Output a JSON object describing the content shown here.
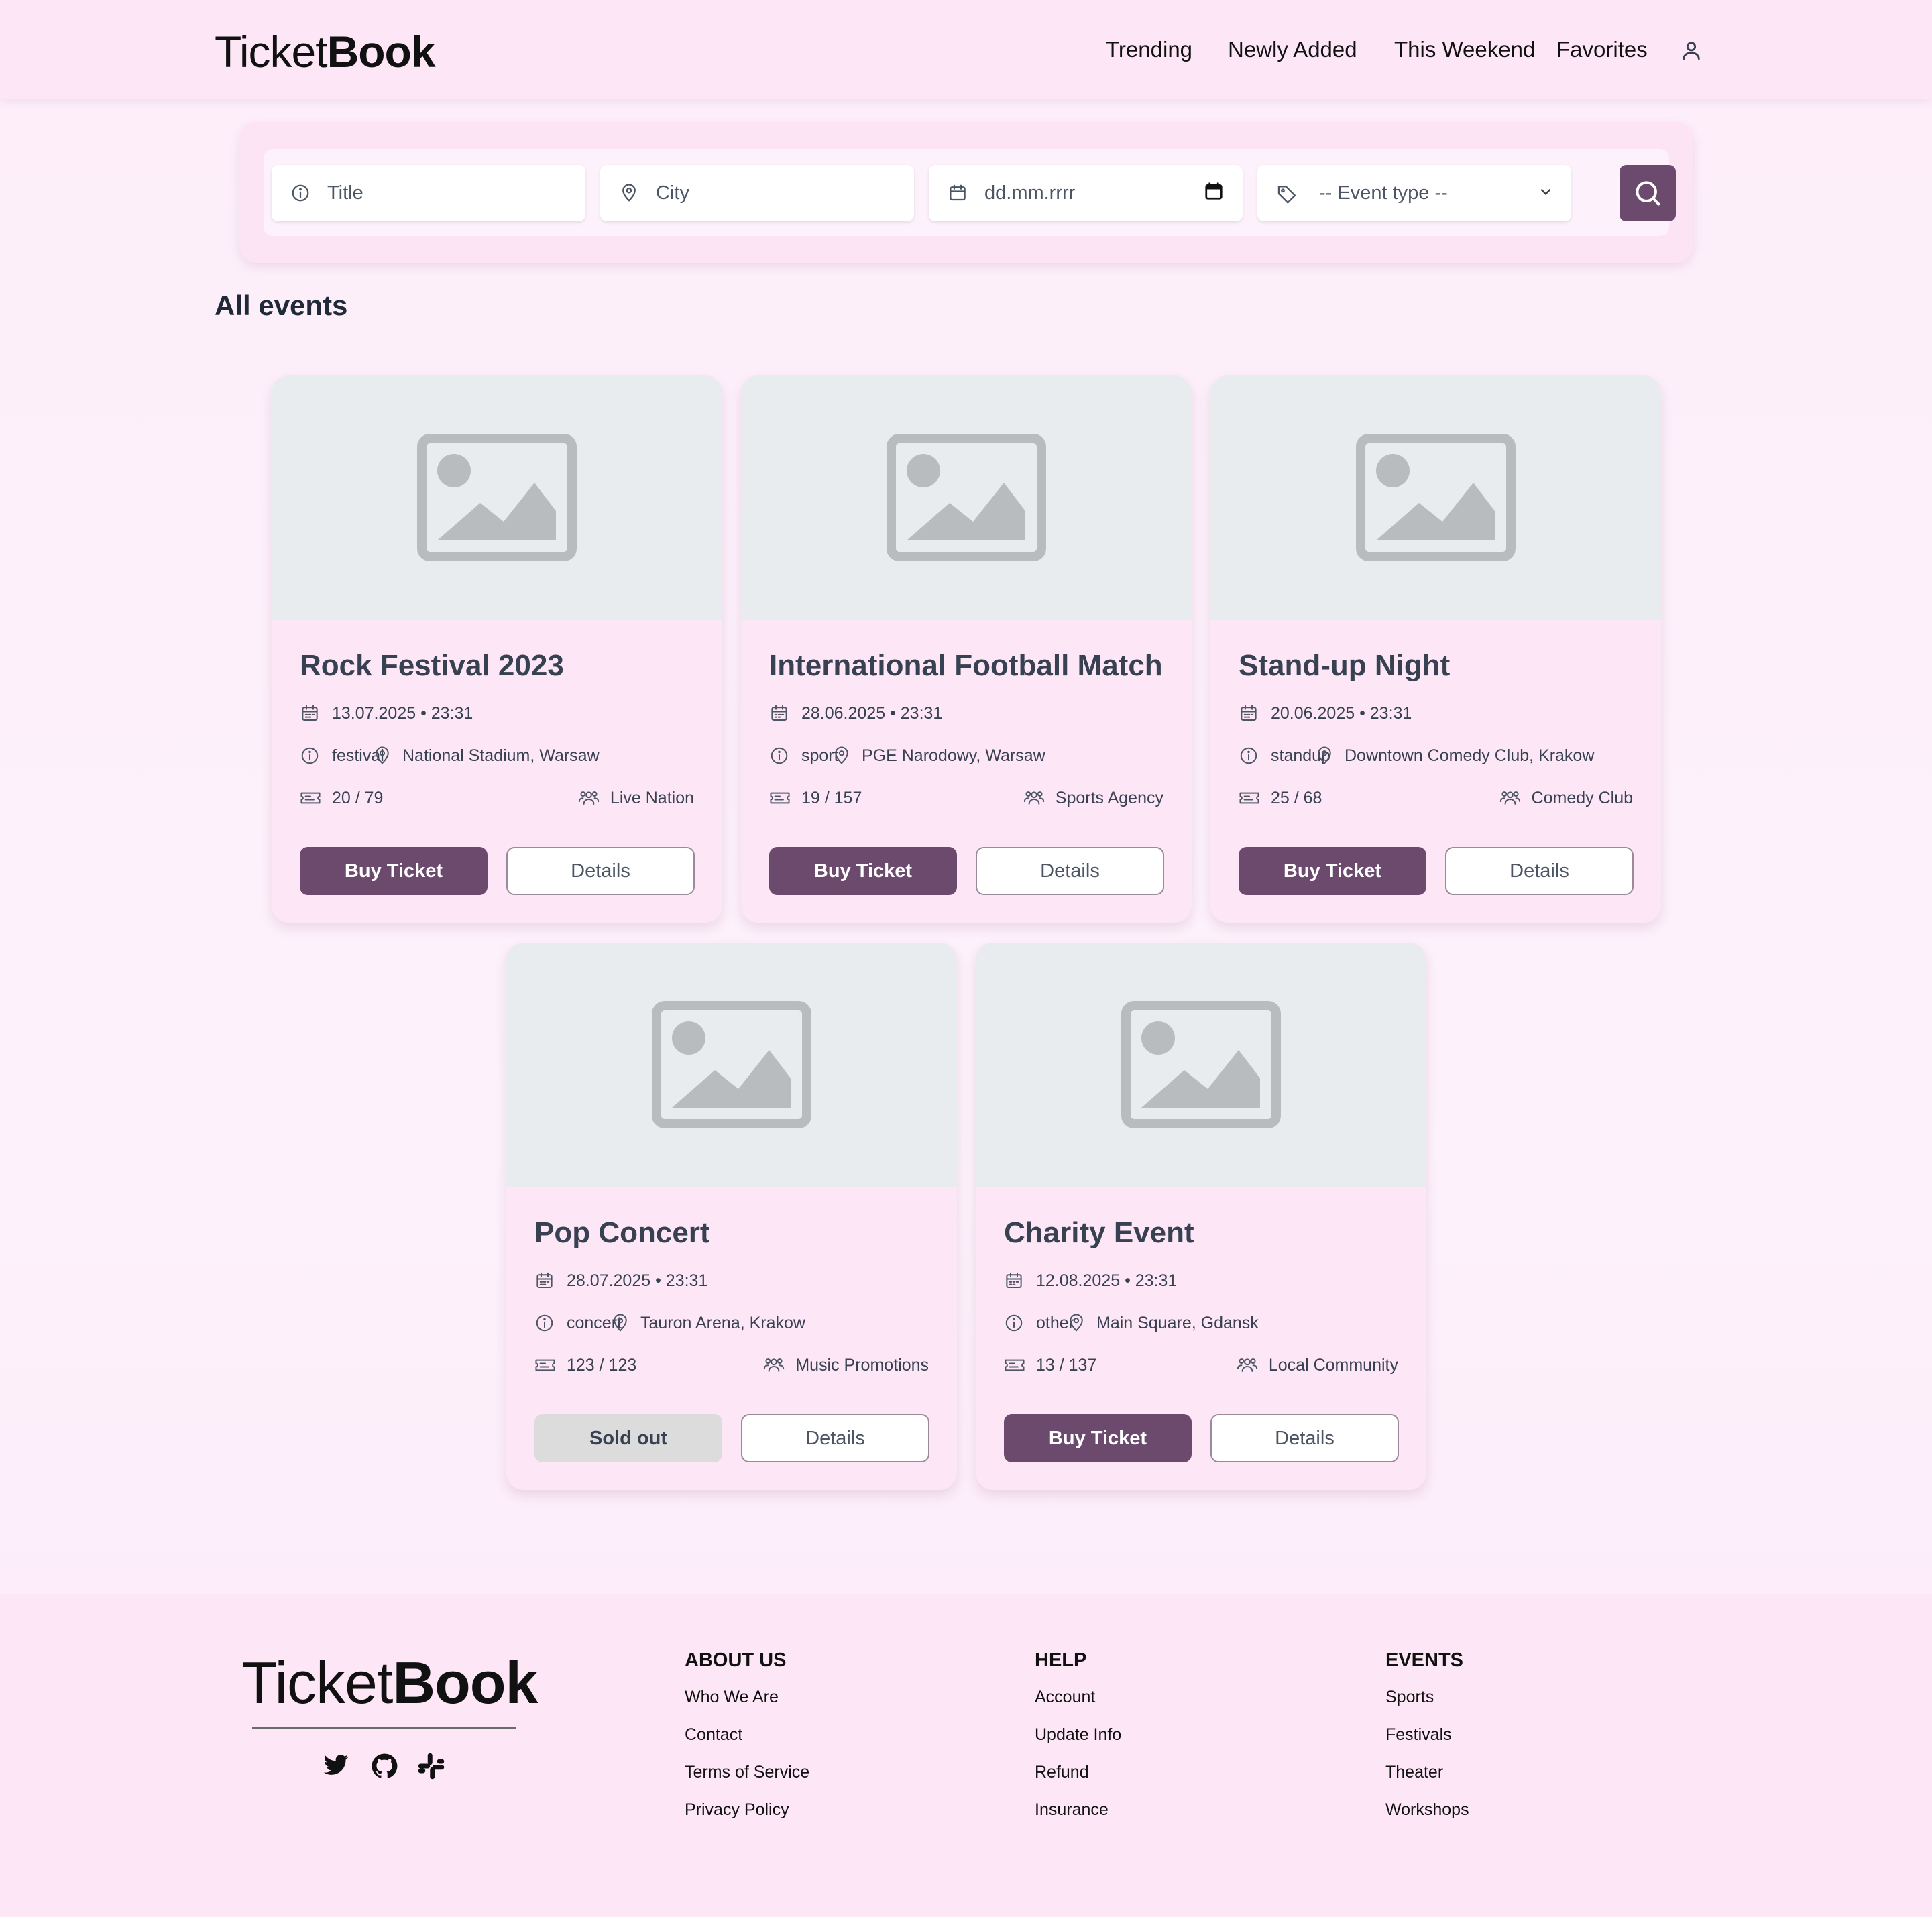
{
  "header": {
    "logo_light": "Ticket",
    "logo_bold": "Book",
    "nav": [
      "Trending",
      "Newly Added",
      "This Weekend",
      "Favorites"
    ]
  },
  "search": {
    "title_placeholder": "Title",
    "city_placeholder": "City",
    "date_placeholder": "dd.mm.rrrr",
    "type_placeholder": "-- Event type --"
  },
  "section_title": "All events",
  "events": [
    {
      "title": "Rock Festival 2023",
      "datetime": "13.07.2025 • 23:31",
      "type": "festival",
      "location": "National Stadium, Warsaw",
      "tickets": "20 / 79",
      "organizer": "Live Nation",
      "buy_label": "Buy Ticket",
      "details_label": "Details",
      "sold_out": false
    },
    {
      "title": "International Football Match",
      "datetime": "28.06.2025 • 23:31",
      "type": "sport",
      "location": "PGE Narodowy, Warsaw",
      "tickets": "19 / 157",
      "organizer": "Sports Agency",
      "buy_label": "Buy Ticket",
      "details_label": "Details",
      "sold_out": false
    },
    {
      "title": "Stand-up Night",
      "datetime": "20.06.2025 • 23:31",
      "type": "standup",
      "location": "Downtown Comedy Club, Krakow",
      "tickets": "25 / 68",
      "organizer": "Comedy Club",
      "buy_label": "Buy Ticket",
      "details_label": "Details",
      "sold_out": false
    },
    {
      "title": "Pop Concert",
      "datetime": "28.07.2025 • 23:31",
      "type": "concert",
      "location": "Tauron Arena, Krakow",
      "tickets": "123 / 123",
      "organizer": "Music Promotions",
      "buy_label": "Sold out",
      "details_label": "Details",
      "sold_out": true
    },
    {
      "title": "Charity Event",
      "datetime": "12.08.2025 • 23:31",
      "type": "other",
      "location": "Main Square, Gdansk",
      "tickets": "13 / 137",
      "organizer": "Local Community",
      "buy_label": "Buy Ticket",
      "details_label": "Details",
      "sold_out": false
    }
  ],
  "footer": {
    "logo_light": "Ticket",
    "logo_bold": "Book",
    "social_icons": [
      "twitter-icon",
      "github-icon",
      "slack-icon"
    ],
    "columns": [
      {
        "heading": "ABOUT US",
        "links": [
          "Who We Are",
          "Contact",
          "Terms of Service",
          "Privacy Policy"
        ]
      },
      {
        "heading": "HELP",
        "links": [
          "Account",
          "Update Info",
          "Refund",
          "Insurance"
        ]
      },
      {
        "heading": "EVENTS",
        "links": [
          "Sports",
          "Festivals",
          "Theater",
          "Workshops"
        ]
      }
    ]
  },
  "colors": {
    "accent": "#6b4a6e",
    "header_bg": "#fde7f7",
    "card_bg": "#fde7f7",
    "image_placeholder_bg": "#e8ecef",
    "sold_out_bg": "#dcdcdc"
  }
}
